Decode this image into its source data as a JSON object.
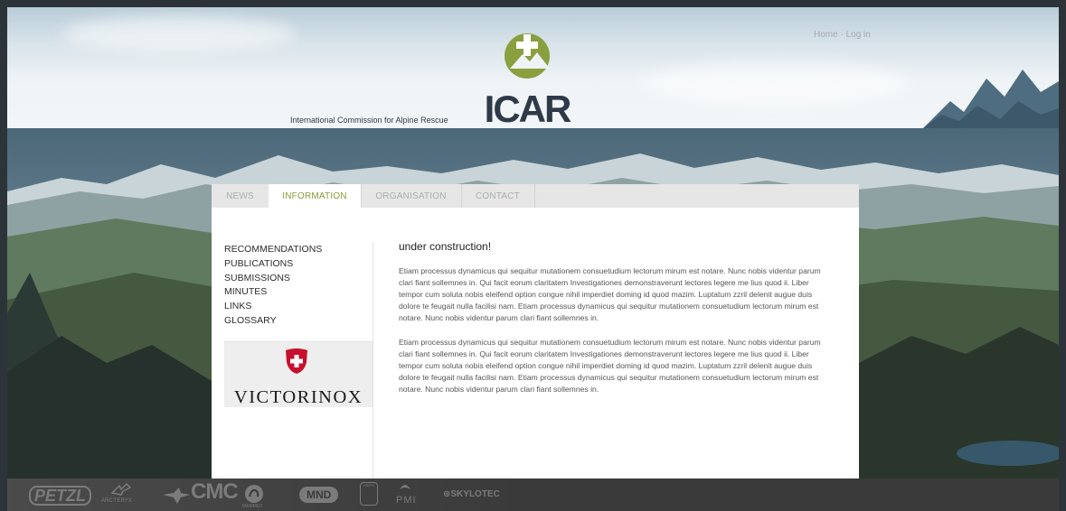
{
  "header": {
    "top_nav": {
      "home": "Home",
      "separator": " · ",
      "login": "Log in"
    },
    "tagline": "International Commission for Alpine Rescue",
    "logo_text": "ICAR"
  },
  "tabs": [
    {
      "label": "NEWS",
      "active": false
    },
    {
      "label": "INFORMATION",
      "active": true
    },
    {
      "label": "ORGANISATION",
      "active": false
    },
    {
      "label": "CONTACT",
      "active": false
    }
  ],
  "sidebar": {
    "items": [
      "RECOMMENDATIONS",
      "PUBLICATIONS",
      "SUBMISSIONS",
      "MINUTES",
      "LINKS",
      "GLOSSARY"
    ],
    "sponsor": "VICTORINOX"
  },
  "article": {
    "title": "under construction!",
    "paragraphs": [
      "Etiam processus dynamicus qui sequitur mutationem consuetudium lectorum mirum est notare. Nunc nobis videntur parum clari fiant sollemnes in. Qui facit eorum claritatem Investigationes demonstraverunt lectores legere me lius quod ii. Liber tempor cum soluta nobis eleifend option congue nihil imperdiet doming id quod mazim. Luptatum zzril delenit augue duis dolore te feugait nulla facilisi nam. Etiam processus dynamicus qui sequitur mutationem consuetudium lectorum mirum est notare. Nunc nobis videntur parum clari fiant sollemnes in.",
      "Etiam processus dynamicus qui sequitur mutationem consuetudium lectorum mirum est notare. Nunc nobis videntur parum clari fiant sollemnes in. Qui facit eorum claritatem Investigationes demonstraverunt lectores legere me lius quod ii. Liber tempor cum soluta nobis eleifend option congue nihil imperdiet doming id quod mazim. Luptatum zzril delenit augue duis dolore te feugait nulla facilisi nam. Etiam processus dynamicus qui sequitur mutationem consuetudium lectorum mirum est notare. Nunc nobis videntur parum clari fiant sollemnes in."
    ]
  },
  "footer_sponsors": [
    "PETZL",
    "ARC'TERYX",
    "CMC",
    "MAMMUT",
    "MND",
    "PIEPS",
    "PMI",
    "SKYLOTEC"
  ],
  "colors": {
    "accent_green": "#8a9a3c",
    "logo_green": "#8aa03f",
    "logo_navy": "#2f3a48",
    "victorinox_red": "#c8102e"
  }
}
